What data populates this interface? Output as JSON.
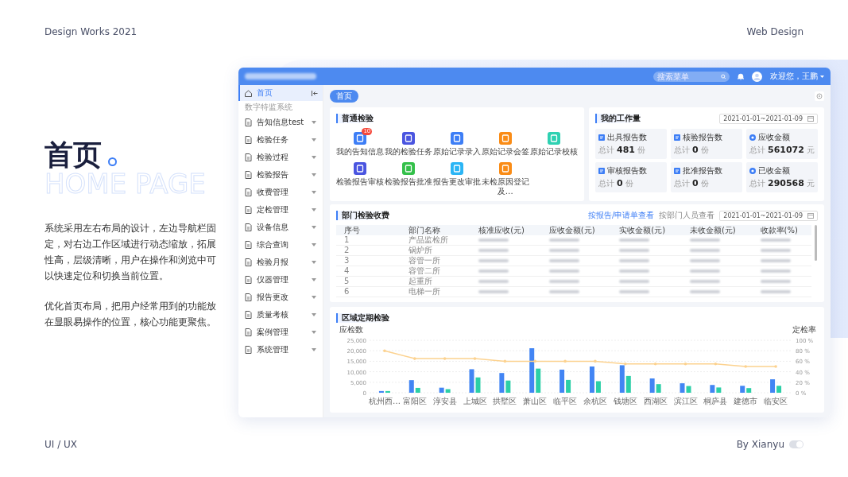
{
  "header": {
    "left": "Design Works 2021",
    "right": "Web Design"
  },
  "intro": {
    "title": "首页",
    "subtitle": "HOME PAGE",
    "paragraphs": [
      "系统采用左右布局的设计，左边导航栏固定，对右边工作区域进行动态缩放，拓展性高，层级清晰，用户在操作和浏览中可以快速定位和切换当前位置。",
      "优化首页布局，把用户经常用到的功能放在显眼易操作的位置，核心功能更聚焦。"
    ]
  },
  "app": {
    "topbar": {
      "search_placeholder": "搜索菜单",
      "user": "欢迎您，王鹏"
    },
    "sidebar": {
      "home": {
        "label": "首页",
        "selected": true
      },
      "section": "数字特监系统",
      "items": [
        {
          "label": "告知信息test",
          "selected": false
        },
        {
          "label": "检验任务",
          "selected": false
        },
        {
          "label": "检验过程",
          "selected": false
        },
        {
          "label": "检验报告",
          "selected": false
        },
        {
          "label": "收费管理",
          "selected": false
        },
        {
          "label": "定检管理",
          "selected": false
        },
        {
          "label": "设备信息",
          "selected": false
        },
        {
          "label": "综合查询",
          "selected": false
        },
        {
          "label": "检验月报",
          "selected": false
        },
        {
          "label": "仪器管理",
          "selected": false
        },
        {
          "label": "报告更改",
          "selected": false
        },
        {
          "label": "质量考核",
          "selected": false
        },
        {
          "label": "案例管理",
          "selected": false
        },
        {
          "label": "系统管理",
          "selected": false
        }
      ]
    },
    "breadcrumb": [
      {
        "label": "首页",
        "selected": true
      }
    ],
    "quick": {
      "title": "普通检验",
      "items": [
        {
          "label": "我的告知信息",
          "color": "#3d7ef6",
          "badge": "10"
        },
        {
          "label": "我的检验任务",
          "color": "#4a55e0"
        },
        {
          "label": "原始记录录入",
          "color": "#3d7ef6"
        },
        {
          "label": "原始记录会签",
          "color": "#fa8c16"
        },
        {
          "label": "原始记录校核",
          "color": "#2ed1b2"
        },
        {
          "label": "检验报告审核",
          "color": "#4a55e0"
        },
        {
          "label": "检验报告批准",
          "color": "#34c04a"
        },
        {
          "label": "报告更改审批",
          "color": "#2bb5f5"
        },
        {
          "label": "未检原因登记及…",
          "color": "#fa8c16"
        }
      ]
    },
    "workload": {
      "title": "我的工作量",
      "date_range": "2021-01-01~2021-01-09",
      "stats": [
        {
          "kind": "count",
          "label": "出具报告数",
          "prefix": "总计",
          "value": "481",
          "unit": "份"
        },
        {
          "kind": "count",
          "label": "核验报告数",
          "prefix": "总计",
          "value": "0",
          "unit": "份"
        },
        {
          "kind": "money",
          "label": "应收金额",
          "prefix": "总计",
          "value": "561072",
          "unit": "元"
        },
        {
          "kind": "count",
          "label": "审核报告数",
          "prefix": "总计",
          "value": "0",
          "unit": "份"
        },
        {
          "kind": "count",
          "label": "批准报告数",
          "prefix": "总计",
          "value": "0",
          "unit": "份"
        },
        {
          "kind": "money",
          "label": "已收金额",
          "prefix": "总计",
          "value": "290568",
          "unit": "元"
        }
      ]
    },
    "fees": {
      "title": "部门检验收费",
      "views": [
        {
          "label": "按报告/申请单查看",
          "selected": true
        },
        {
          "label": "按部门人员查看",
          "selected": false
        }
      ],
      "date_range": "2021-01-01~2021-01-09",
      "columns": [
        "序号",
        "部门名称",
        "核准应收(元)",
        "应收金额(元)",
        "实收金额(元)",
        "未收金额(元)",
        "收款率(%)"
      ],
      "rows": [
        [
          "1",
          "产品监检所"
        ],
        [
          "2",
          "锅炉所"
        ],
        [
          "3",
          "容管一所"
        ],
        [
          "4",
          "容管二所"
        ],
        [
          "5",
          "起重所"
        ],
        [
          "6",
          "电梯一所"
        ]
      ]
    },
    "regional": {
      "chart_data": {
        "type": "bar",
        "title": "区域定期检验",
        "ylabel": "应检数",
        "y2label": "定检率",
        "categories": [
          "杭州西…",
          "富阳区",
          "淳安县",
          "上城区",
          "拱墅区",
          "萧山区",
          "临平区",
          "余杭区",
          "钱塘区",
          "西湖区",
          "滨江区",
          "桐庐县",
          "建德市",
          "临安区"
        ],
        "series": [
          {
            "color": "#4285f4",
            "values": [
              800,
              6000,
              2400,
              11200,
              9400,
              21200,
              11000,
              12500,
              13100,
              6800,
              4500,
              3700,
              3300,
              6400
            ]
          },
          {
            "color": "#2ccfa7",
            "values": [
              800,
              2300,
              1700,
              7300,
              5800,
              11500,
              6100,
              5500,
              8000,
              4100,
              3200,
              2500,
              2200,
              3300
            ]
          },
          {
            "type": "line",
            "axis": "y2",
            "color": "#fcd28f",
            "values": [
              80,
              65,
              65,
              65,
              60,
              60,
              60,
              60,
              55,
              55,
              55,
              55,
              50,
              50
            ]
          }
        ],
        "grid": true,
        "ylim": [
          0,
          25000
        ],
        "yticks": [
          {
            "value": 0,
            "label": "0"
          },
          {
            "value": 5000,
            "label": "5,000"
          },
          {
            "value": 10000,
            "label": "10,000"
          },
          {
            "value": 15000,
            "label": "15,000"
          },
          {
            "value": 20000,
            "label": "20,000"
          },
          {
            "value": 25000,
            "label": "25,000"
          }
        ],
        "y2lim": [
          0,
          100
        ],
        "y2ticks": [
          {
            "value": 0,
            "label": "0 %"
          },
          {
            "value": 20,
            "label": "20 %"
          },
          {
            "value": 40,
            "label": "40 %"
          },
          {
            "value": 60,
            "label": "60 %"
          },
          {
            "value": 80,
            "label": "80 %"
          },
          {
            "value": 100,
            "label": "100 %"
          }
        ]
      }
    }
  },
  "footer": {
    "left": "UI / UX",
    "right": "By Xianyu"
  }
}
